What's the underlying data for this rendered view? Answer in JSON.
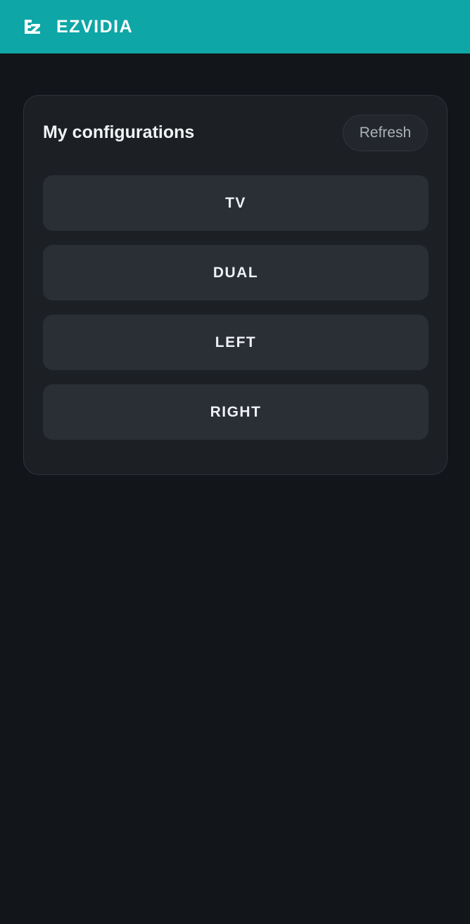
{
  "app": {
    "title": "EZVIDIA",
    "logo_text": "EZ",
    "accent_color": "#0ea6a6"
  },
  "configurations": {
    "heading": "My configurations",
    "refresh_label": "Refresh",
    "items": [
      {
        "label": "TV"
      },
      {
        "label": "DUAL"
      },
      {
        "label": "LEFT"
      },
      {
        "label": "RIGHT"
      }
    ]
  }
}
